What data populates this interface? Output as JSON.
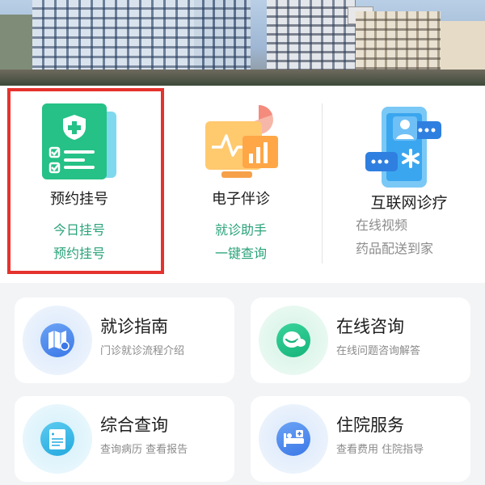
{
  "services": [
    {
      "name": "预约挂号",
      "subs": [
        "今日挂号",
        "预约挂号"
      ],
      "icon": "registration-card-icon"
    },
    {
      "name": "电子伴诊",
      "subs": [
        "就诊助手",
        "一键查询"
      ],
      "icon": "monitor-chart-icon"
    },
    {
      "name": "互联网诊疗",
      "subs": [
        "在线视频",
        "药品配送到家"
      ],
      "icon": "phone-consult-icon"
    }
  ],
  "tiles": [
    {
      "title": "就诊指南",
      "desc": "门诊就诊流程介绍",
      "icon": "map-guide-icon"
    },
    {
      "title": "在线咨询",
      "desc": "在线问题咨询解答",
      "icon": "chat-bubble-icon"
    },
    {
      "title": "综合查询",
      "desc": "查询病历 查看报告",
      "icon": "document-icon"
    },
    {
      "title": "住院服务",
      "desc": "查看费用 住院指导",
      "icon": "hospital-bed-icon"
    }
  ],
  "colors": {
    "accent_green": "#2aa37a",
    "highlight_red": "#e5322d",
    "blue": "#3b78e7",
    "green": "#16b47c"
  }
}
